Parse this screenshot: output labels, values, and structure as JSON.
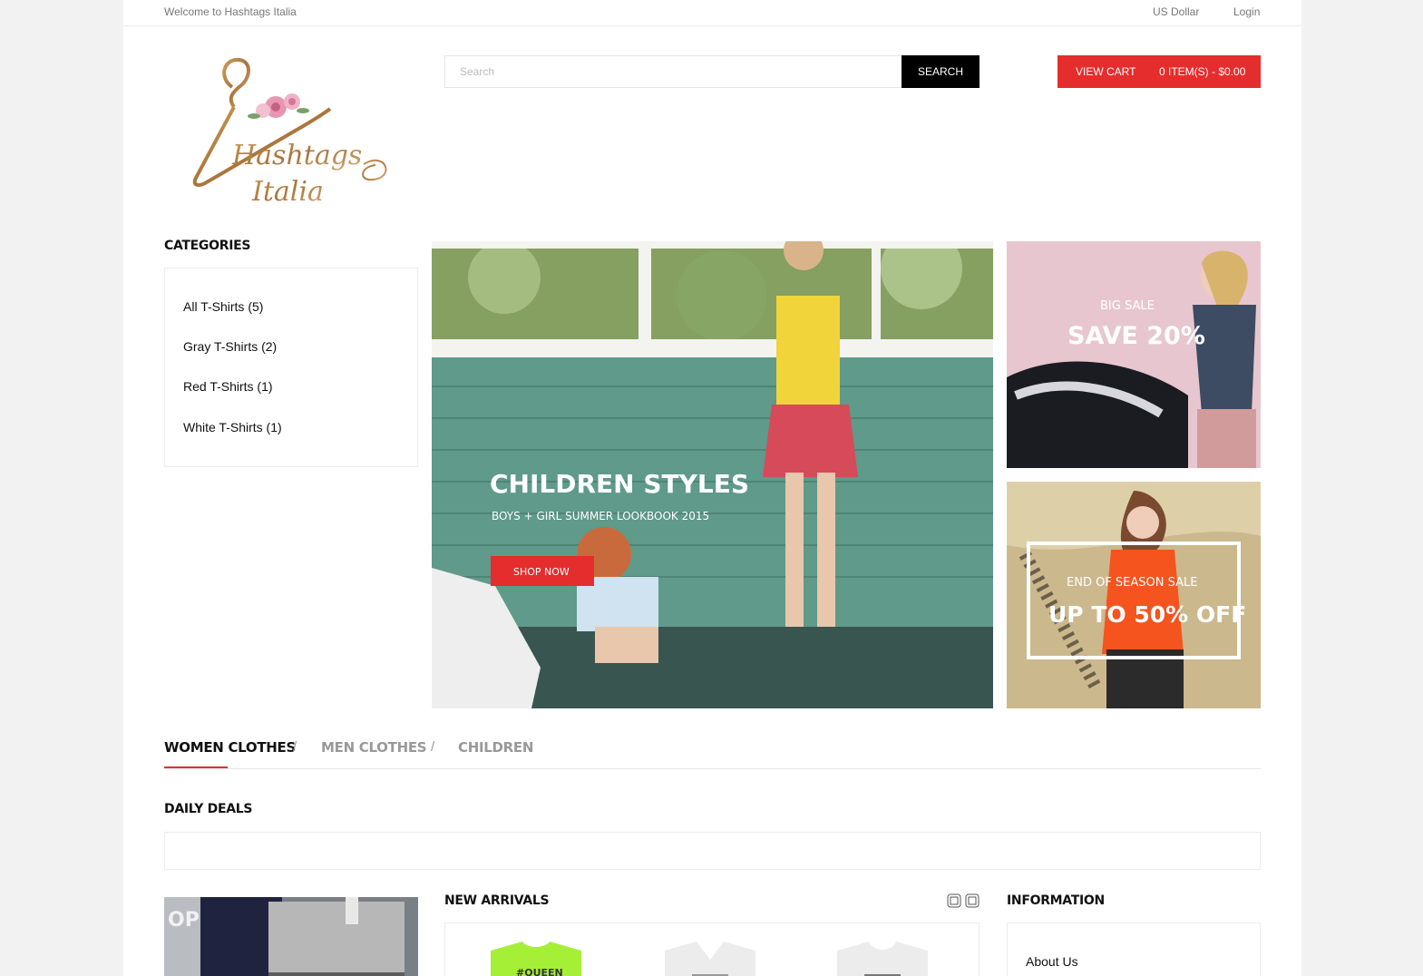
{
  "topbar": {
    "welcome": "Welcome to Hashtags Italia",
    "currency": "US Dollar",
    "login": "Login"
  },
  "logo": {
    "line1": "Hashtags",
    "line2": "Italia"
  },
  "search": {
    "placeholder": "Search",
    "button": "SEARCH"
  },
  "cart": {
    "view_label": "VIEW CART",
    "summary": "0 ITEM(S) - $0.00"
  },
  "categories": {
    "title": "CATEGORIES",
    "items": [
      "All T-Shirts (5)",
      "Gray T-Shirts (2)",
      "Red T-Shirts (1)",
      "White T-Shirts (1)"
    ]
  },
  "hero": {
    "title": "CHILDREN STYLES",
    "subtitle": "BOYS + GIRL SUMMER LOOKBOOK 2015",
    "button": "SHOP NOW"
  },
  "promo1": {
    "kicker": "BIG SALE",
    "headline": "SAVE 20%"
  },
  "promo2": {
    "kicker": "END OF SEASON SALE",
    "headline": "UP TO 50% OFF"
  },
  "tabs": [
    {
      "label": "WOMEN CLOTHES"
    },
    {
      "label": "MEN CLOTHES"
    },
    {
      "label": "CHILDREN"
    }
  ],
  "tab_separator": "/",
  "daily_deals": {
    "title": "DAILY DEALS"
  },
  "new_arrivals": {
    "title": "NEW ARRIVALS",
    "shirt_text": "#QUEEN"
  },
  "information": {
    "title": "INFORMATION",
    "items": [
      "About Us"
    ]
  },
  "colors": {
    "accent": "#e52d2d",
    "dark": "#000000",
    "text": "#111111",
    "muted": "#999999"
  }
}
